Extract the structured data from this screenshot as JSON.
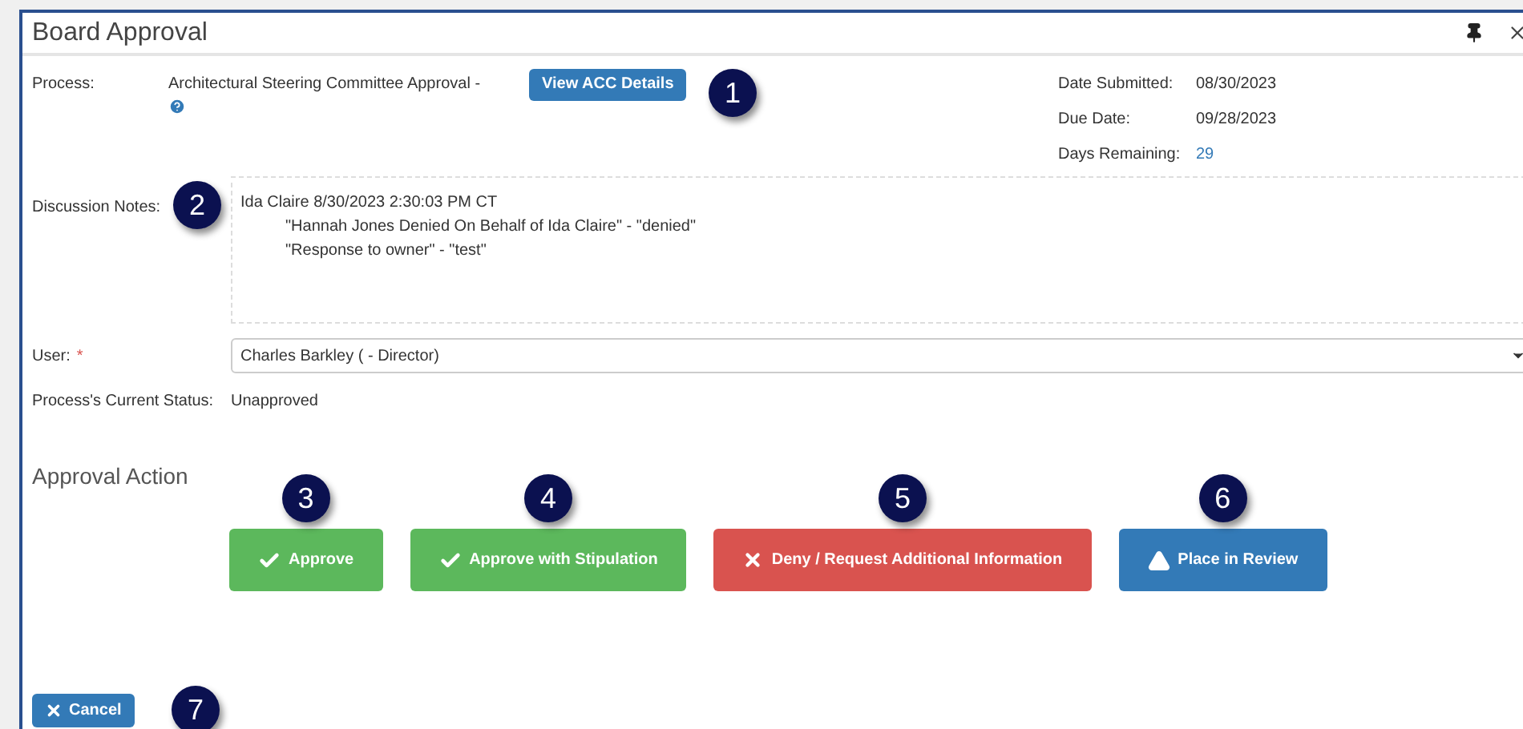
{
  "window": {
    "title": "Board Approval"
  },
  "process": {
    "label": "Process:",
    "value": "Architectural Steering Committee Approval -",
    "button": "View ACC Details"
  },
  "dates": [
    {
      "label": "Date Submitted:",
      "value": "08/30/2023",
      "kind": "plain"
    },
    {
      "label": "Due Date:",
      "value": "09/28/2023",
      "kind": "plain"
    },
    {
      "label": "Days Remaining:",
      "value": "29",
      "kind": "link"
    }
  ],
  "notes": {
    "label": "Discussion Notes:",
    "lines": [
      {
        "text": "Ida Claire 8/30/2023 2:30:03 PM CT",
        "indented": false
      },
      {
        "text": "\"Hannah Jones Denied On Behalf of Ida Claire\" - \"denied\"",
        "indented": true
      },
      {
        "text": "\"Response to owner\" - \"test\"",
        "indented": true
      }
    ]
  },
  "user": {
    "label": "User:",
    "required_mark": "*",
    "value": "Charles Barkley ( - Director)"
  },
  "status": {
    "label": "Process's Current Status:",
    "value": "Unapproved"
  },
  "approval": {
    "heading": "Approval Action",
    "buttons": [
      {
        "label": "Approve",
        "kind": "approve",
        "callout": "3"
      },
      {
        "label": "Approve with Stipulation",
        "kind": "approve",
        "callout": "4"
      },
      {
        "label": "Deny / Request Additional Information",
        "kind": "deny",
        "callout": "5"
      },
      {
        "label": "Place in Review",
        "kind": "review",
        "callout": "6"
      }
    ]
  },
  "cancel": {
    "label": "Cancel",
    "callout": "7"
  },
  "callouts": {
    "process": "1",
    "notes": "2"
  }
}
